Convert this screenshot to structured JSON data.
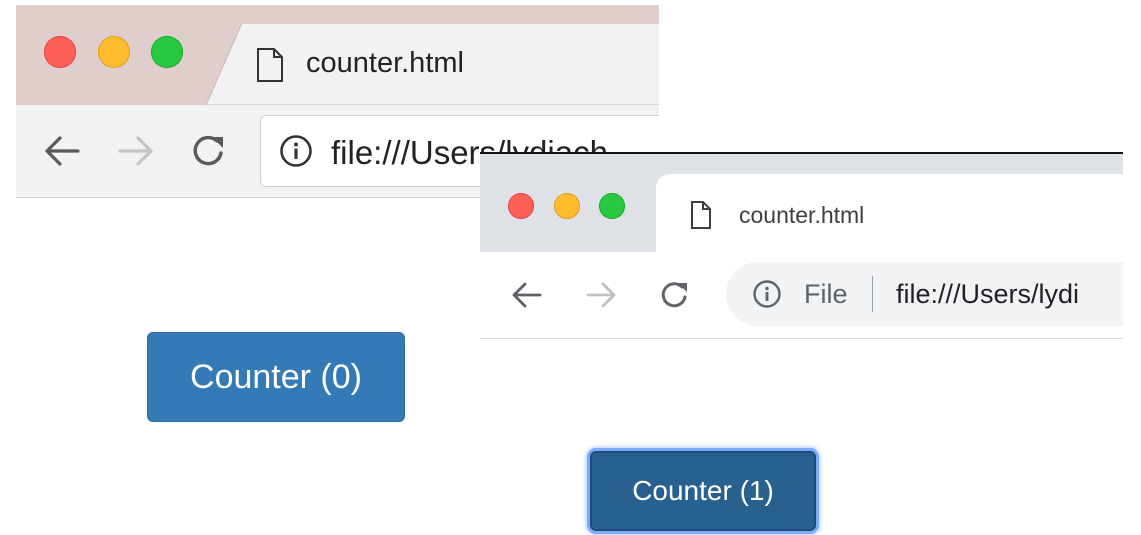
{
  "window_old": {
    "tab_title": "counter.html",
    "url": "file:///Users/lydiach",
    "counter_button_label": "Counter (0)",
    "colors": {
      "tabstrip": "#e0cecd",
      "button": "#337ab7"
    },
    "icons": [
      "file-icon",
      "back-arrow-icon",
      "forward-arrow-icon",
      "reload-icon",
      "info-icon"
    ]
  },
  "window_new": {
    "tab_title": "counter.html",
    "security_chip": "File",
    "url": "file:///Users/lydi",
    "counter_button_label": "Counter (1)",
    "colors": {
      "tabstrip": "#dee1e6",
      "button": "#286090",
      "focus_ring": "#7aa9ff"
    },
    "icons": [
      "file-icon",
      "back-arrow-icon",
      "forward-arrow-icon",
      "reload-icon",
      "info-icon"
    ]
  }
}
